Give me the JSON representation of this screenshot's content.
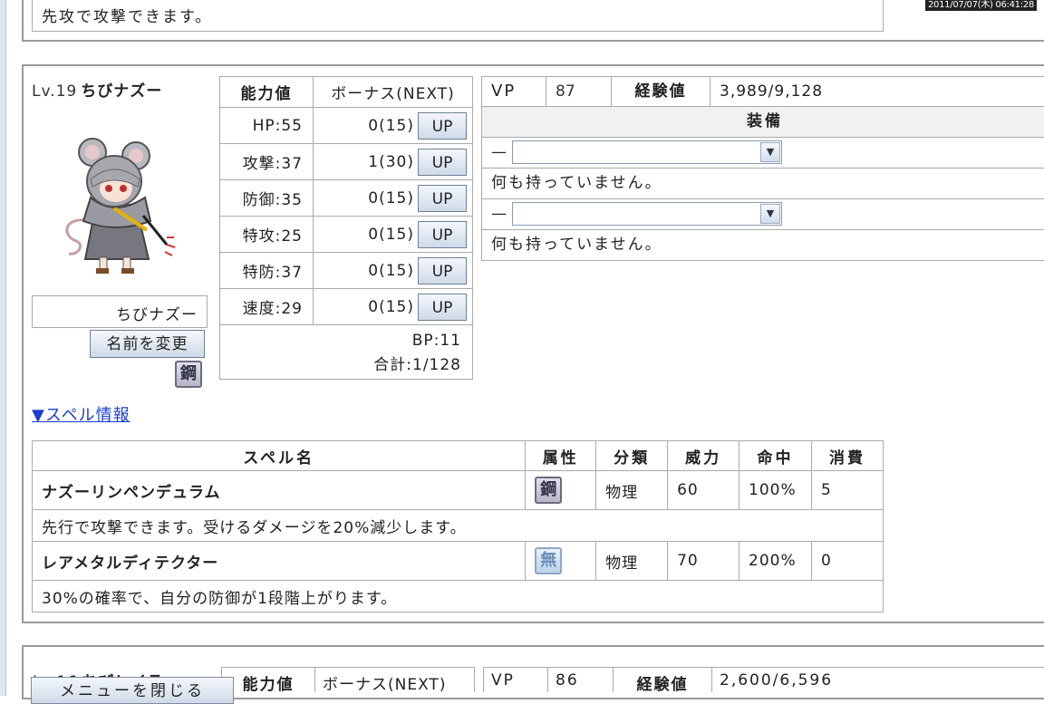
{
  "timestamp": "2011/07/07(木) 06:41:28",
  "top_panel": {
    "description": "先攻で攻撃できます。"
  },
  "character": {
    "level": "Lv.19",
    "name": "ちびナズー",
    "name_field_value": "ちびナズー",
    "rename_button": "名前を変更",
    "type_icon": {
      "label": "鋼",
      "name": "steel-type-icon"
    }
  },
  "stats": {
    "header_stat": "能力値",
    "header_bonus": "ボーナス(NEXT)",
    "up_label": "UP",
    "rows": [
      {
        "stat": "HP:55",
        "bonus": "0(15)"
      },
      {
        "stat": "攻撃:37",
        "bonus": "1(30)"
      },
      {
        "stat": "防御:35",
        "bonus": "0(15)"
      },
      {
        "stat": "特攻:25",
        "bonus": "0(15)"
      },
      {
        "stat": "特防:37",
        "bonus": "0(15)"
      },
      {
        "stat": "速度:29",
        "bonus": "0(15)"
      }
    ],
    "bp": "BP:11",
    "total": "合計:1/128"
  },
  "vp": {
    "label": "VP",
    "value": "87"
  },
  "experience": {
    "label": "経験値",
    "value": "3,989/9,128"
  },
  "equipment": {
    "header": "装備",
    "slots": [
      {
        "prefix": "—",
        "selected": "",
        "status": "何も持っていません。"
      },
      {
        "prefix": "—",
        "selected": "",
        "status": "何も持っていません。"
      }
    ]
  },
  "spell_link": "▼スペル情報",
  "spells": {
    "headers": {
      "name": "スペル名",
      "attribute": "属性",
      "category": "分類",
      "power": "威力",
      "accuracy": "命中",
      "cost": "消費"
    },
    "rows": [
      {
        "name": "ナズーリンペンデュラム",
        "attribute": "鋼",
        "attribute_icon": "steel-type-icon",
        "category": "物理",
        "power": "60",
        "accuracy": "100%",
        "cost": "5",
        "description": "先行で攻撃できます。受けるダメージを20%減少します。"
      },
      {
        "name": "レアメタルディテクター",
        "attribute": "無",
        "attribute_icon": "neutral-type-icon",
        "category": "物理",
        "power": "70",
        "accuracy": "200%",
        "cost": "0",
        "description": "30%の確率で、自分の防御が1段階上がります。"
      }
    ]
  },
  "next_character": {
    "level": "Lv.16",
    "name": "ちびレイラ",
    "header_stat": "能力値",
    "header_bonus": "ボーナス(NEXT)",
    "vp_label": "VP",
    "vp_value": "86",
    "exp_label": "経験値",
    "exp_value": "2,600/6,596"
  },
  "menu_button": "メニューを閉じる",
  "colors": {
    "link": "#1a3fd0",
    "border": "#aaaaaa",
    "panel_border": "#9a9a9a",
    "button_top": "#f3f7fb",
    "button_bottom": "#cfdbe8"
  }
}
